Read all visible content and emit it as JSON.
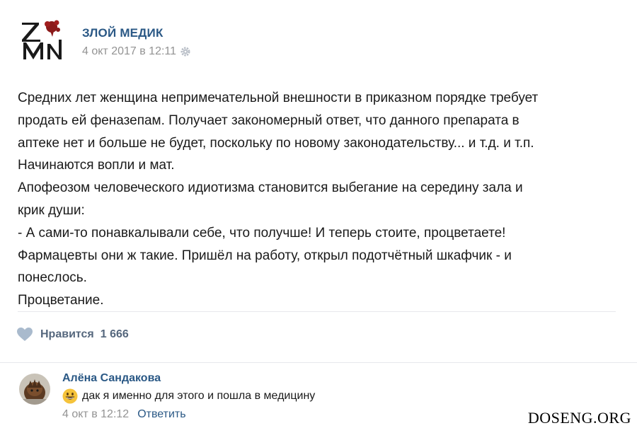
{
  "post": {
    "author": "ЗЛОЙ МЕДИК",
    "date": "4 окт 2017 в 12:11",
    "lines": [
      "Средних лет женщина непримечательной внешности в приказном порядке требует",
      "продать ей феназепам. Получает закономерный ответ, что данного препарата в",
      "аптеке нет и больше не будет, поскольку по новому законодательству... и т.д. и т.п.",
      "Начинаются вопли и мат.",
      "Апофеозом человеческого идиотизма становится выбегание на середину зала и",
      "крик души:",
      "- А сами-то понавкалывали себе, что получше! И теперь стоите, процветаете!",
      "Фармацевты они ж такие. Пришёл на работу, открыл подотчётный шкафчик - и",
      "понеслось.",
      "Процветание."
    ],
    "like_label": "Нравится",
    "like_count": "1 666"
  },
  "comment": {
    "author": "Алёна Сандакова",
    "text": "дак я именно для этого и пошла в медицину",
    "date": "4 окт в 12:12",
    "reply_label": "Ответить"
  },
  "watermark": "DOSENG.ORG",
  "icons": {
    "logo": "zm-logo-icon",
    "settings": "gear-icon",
    "like": "heart-icon",
    "emoji": "smile-emoji-icon"
  },
  "colors": {
    "link": "#2a5885",
    "meta": "#939393",
    "like": "#55677d"
  }
}
